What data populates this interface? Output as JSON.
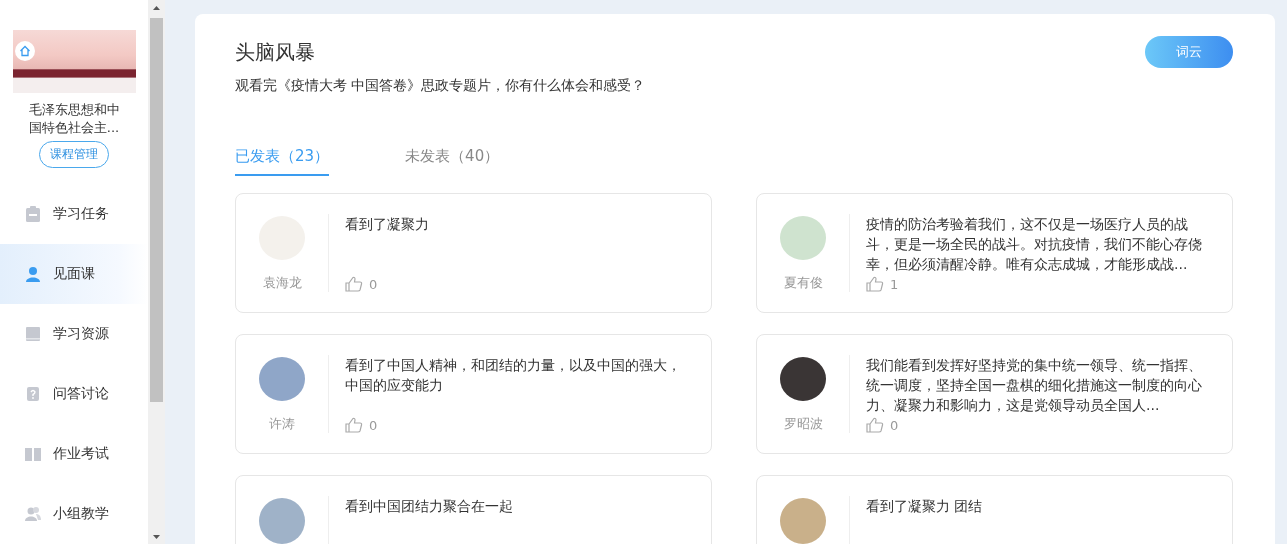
{
  "sidebar": {
    "course_title": "毛泽东思想和中国特色社会主...",
    "manage_button": "课程管理",
    "nav": [
      {
        "label": "学习任务",
        "selected": false
      },
      {
        "label": "见面课",
        "selected": true
      },
      {
        "label": "学习资源",
        "selected": false
      },
      {
        "label": "问答讨论",
        "selected": false
      },
      {
        "label": "作业考试",
        "selected": false
      },
      {
        "label": "小组教学",
        "selected": false
      }
    ]
  },
  "panel": {
    "title": "头脑风暴",
    "word_cloud_button": "词云",
    "question": "观看完《疫情大考 中国答卷》思政专题片，你有什么体会和感受？",
    "tabs": [
      {
        "label": "已发表（23）",
        "selected": true
      },
      {
        "label": "未发表（40）",
        "selected": false
      }
    ],
    "comments": [
      {
        "name": "袁海龙",
        "text": "看到了凝聚力",
        "likes": "0"
      },
      {
        "name": "夏有俊",
        "text": "疫情的防治考验着我们，这不仅是一场医疗人员的战斗，更是一场全民的战斗。对抗疫情，我们不能心存侥幸，但必须清醒冷静。唯有众志成城，才能形成战...",
        "likes": "1"
      },
      {
        "name": "许涛",
        "text": "看到了中国人精神，和团结的力量，以及中国的强大，中国的应变能力",
        "likes": "0"
      },
      {
        "name": "罗昭波",
        "text": "我们能看到发挥好坚持党的集中统一领导、统一指挥、统一调度，坚持全国一盘棋的细化措施这一制度的向心力、凝聚力和影响力，这是党领导动员全国人...",
        "likes": "0"
      },
      {
        "text": "看到中国团结力聚合在一起"
      },
      {
        "text": "看到了凝聚力 团结"
      }
    ]
  }
}
